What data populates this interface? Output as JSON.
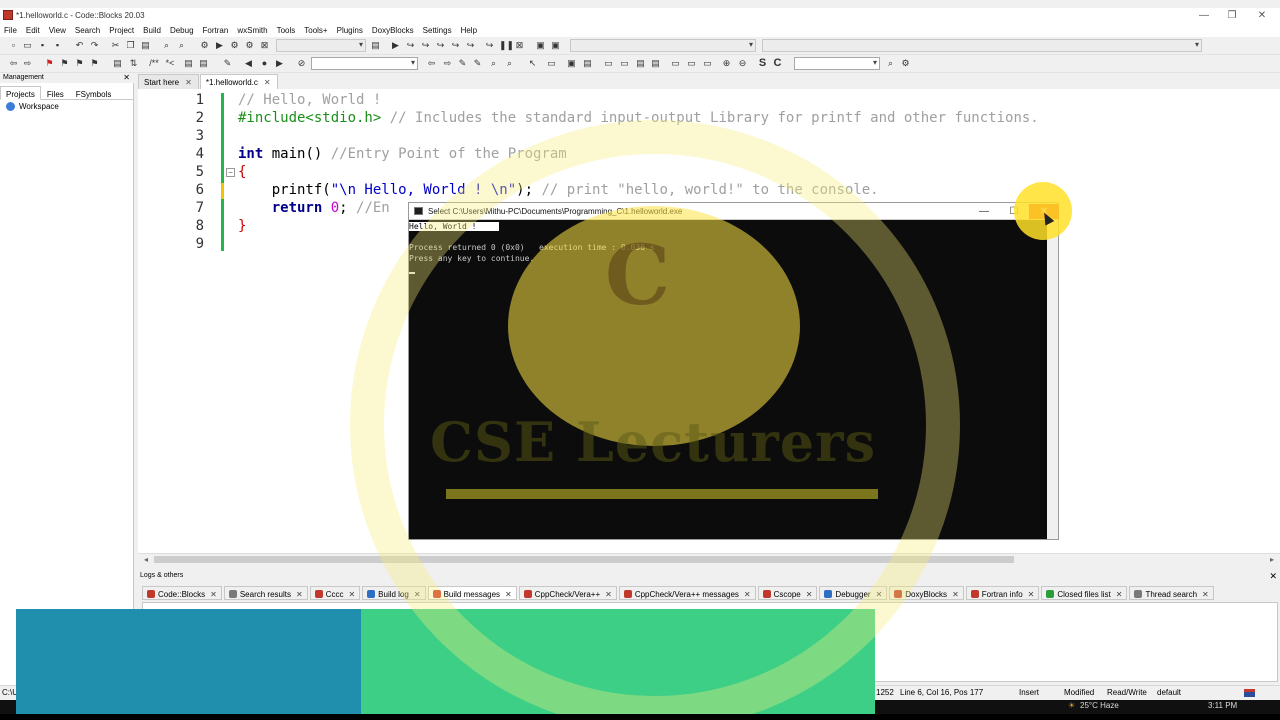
{
  "window": {
    "title": "*1.helloworld.c - Code::Blocks 20.03",
    "controls": [
      "—",
      "❐",
      "✕"
    ]
  },
  "menu": [
    "File",
    "Edit",
    "View",
    "Search",
    "Project",
    "Build",
    "Debug",
    "Fortran",
    "wxSmith",
    "Tools",
    "Tools+",
    "Plugins",
    "DoxyBlocks",
    "Settings",
    "Help"
  ],
  "toolbar": {
    "bold_s": "S",
    "bold_c": "C",
    "comment_block": "/**",
    "comment_line": "*<"
  },
  "management": {
    "title": "Management",
    "close": "✕",
    "tabs": [
      "Projects",
      "Files",
      "FSymbols"
    ],
    "workspace": "Workspace"
  },
  "editor": {
    "tabs": [
      {
        "label": "Start here",
        "close": "✕"
      },
      {
        "label": "*1.helloworld.c",
        "close": "✕"
      }
    ],
    "line_numbers": [
      "1",
      "2",
      "3",
      "4",
      "5",
      "6",
      "7",
      "8",
      "9"
    ],
    "lines": {
      "l1_comment": "// Hello, World !",
      "l2_include": "#include<stdio.h>",
      "l2_comment": " // Includes the standard input-output Library for printf and other functions.",
      "l4_type": "int",
      "l4_name": " main() ",
      "l4_comment": "//Entry Point of the Program",
      "l5_brace": "{",
      "l6_func": "    printf(",
      "l6_str": "\"\\n Hello, World ! \\n\"",
      "l6_end": "); ",
      "l6_comment": "// print \"hello, world!\" to the console.",
      "l7_kw": "    return",
      "l7_num": " 0",
      "l7_semi": "; ",
      "l7_comment": "//En",
      "l8_brace": "}"
    },
    "fold_marks": [
      "−",
      "−"
    ]
  },
  "logs": {
    "title": "Logs & others",
    "close": "✕",
    "tabs": [
      {
        "label": "Code::Blocks",
        "color": "#c0392b"
      },
      {
        "label": "Search results",
        "color": "#7a7a7a"
      },
      {
        "label": "Cccc",
        "color": "#c0392b"
      },
      {
        "label": "Build log",
        "color": "#2f6fc2"
      },
      {
        "label": "Build messages",
        "color": "#d0302a"
      },
      {
        "label": "CppCheck/Vera++",
        "color": "#c0392b"
      },
      {
        "label": "CppCheck/Vera++ messages",
        "color": "#c0392b"
      },
      {
        "label": "Cscope",
        "color": "#c0392b"
      },
      {
        "label": "Debugger",
        "color": "#2f6fc2"
      },
      {
        "label": "DoxyBlocks",
        "color": "#c0392b"
      },
      {
        "label": "Fortran info",
        "color": "#c0392b"
      },
      {
        "label": "Closed files list",
        "color": "#2a9d3a"
      },
      {
        "label": "Thread search",
        "color": "#7a7a7a"
      }
    ],
    "tab_close": "✕"
  },
  "statusbar": {
    "path": "C:\\U",
    "encoding": "1252",
    "position": "Line 6, Col 16, Pos 177",
    "mode": "Insert",
    "modified": "Modified",
    "access": "Read/Write",
    "lang": "default"
  },
  "taskbar": {
    "weather": "25°C  Haze",
    "time": "3:11 PM"
  },
  "console": {
    "title": "Select C:\\Users\\Mithu-PC\\Documents\\Programming_C\\1.helloworld.exe",
    "line1": "Hello, World ! ",
    "line2": "Process returned 0 (0x0)   execution time : 0.036 s",
    "line3": "Press any key to continue.",
    "controls": [
      "—",
      "☐",
      "✕"
    ]
  },
  "watermark": {
    "letter": "C",
    "text": "CSE Lecturers"
  },
  "colors": {
    "overlay_blue": "#1f8fad",
    "overlay_green": "#3ecf87",
    "comment": "#a0a0a0",
    "preprocessor": "#1a8f1a",
    "keyword": "#00008b",
    "string": "#0000cc"
  }
}
